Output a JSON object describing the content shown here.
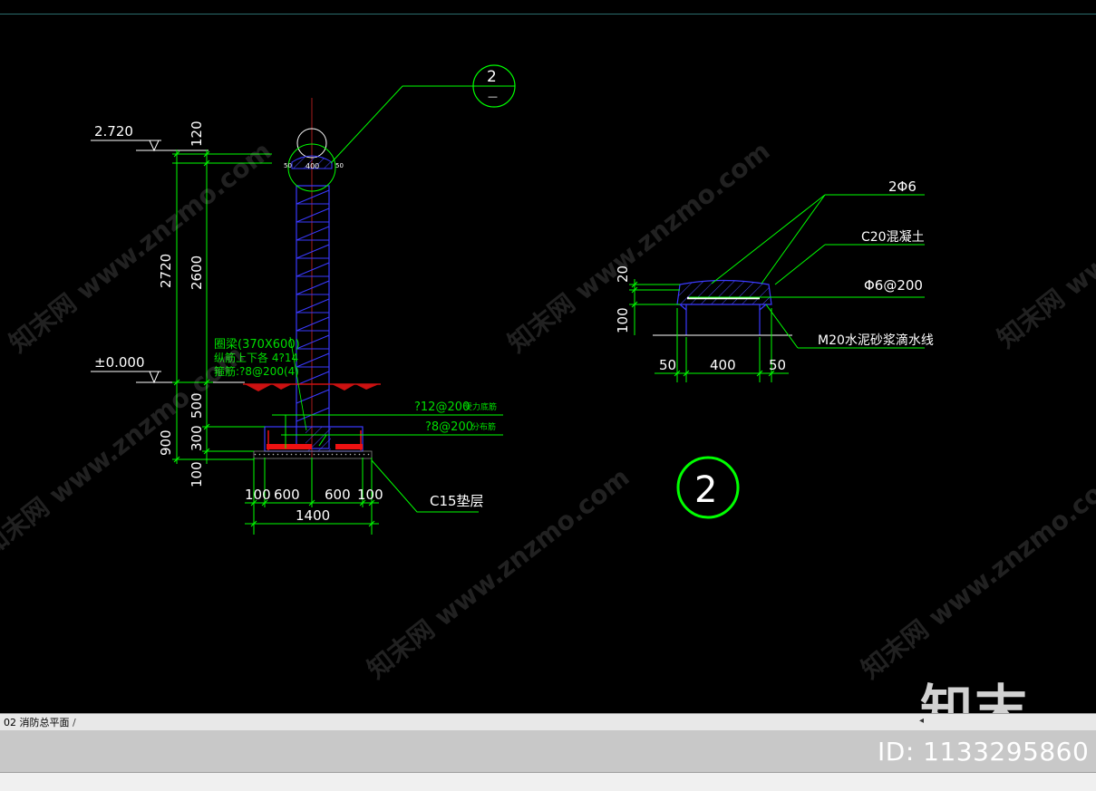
{
  "drawing": {
    "elev_top": "2.720",
    "elev_zero": "±0.000",
    "dim_120": "120",
    "dim_2720": "2720",
    "dim_2600": "2600",
    "dim_500": "500",
    "dim_300": "300",
    "dim_900": "900",
    "dim_100_v": "100",
    "dim_50_l": "50",
    "dim_400_top": "400",
    "dim_50_r": "50",
    "ring_beam_1": "圈梁(370X600)",
    "ring_beam_2": "纵筋上下各 4?14",
    "ring_beam_3": "箍筋:?8@200(4)",
    "rebar_1": "?12@200",
    "rebar_1_tag": "受力底筋",
    "rebar_2": "?8@200",
    "rebar_2_tag": "分布筋",
    "base_dims": [
      "100",
      "600",
      "600",
      "100"
    ],
    "base_total": "1400",
    "cushion_label": "C15垫层",
    "callout_num": "2",
    "callout_sub": "—"
  },
  "detail": {
    "rebar_main": "2Φ6",
    "concrete": "C20混凝土",
    "stirrup": "Φ6@200",
    "mortar": "M20水泥砂浆滴水线",
    "dim_20": "20",
    "dim_100": "100",
    "dim_50_l": "50",
    "dim_400": "400",
    "dim_50_r": "50",
    "section_num": "2"
  },
  "tabbar": {
    "tab_label": "02 消防总平面"
  },
  "watermark": {
    "site_text": "知末网 www.znzmo.com",
    "logo_text": "知末",
    "id_text": "ID: 1133295860"
  },
  "colors": {
    "background": "#000000",
    "dimension": "#00ff00",
    "leader": "#00c800",
    "text_white": "#ffffff",
    "structure": "#3a3aff",
    "hatch": "#cc1111",
    "callout": "#00ff00"
  }
}
